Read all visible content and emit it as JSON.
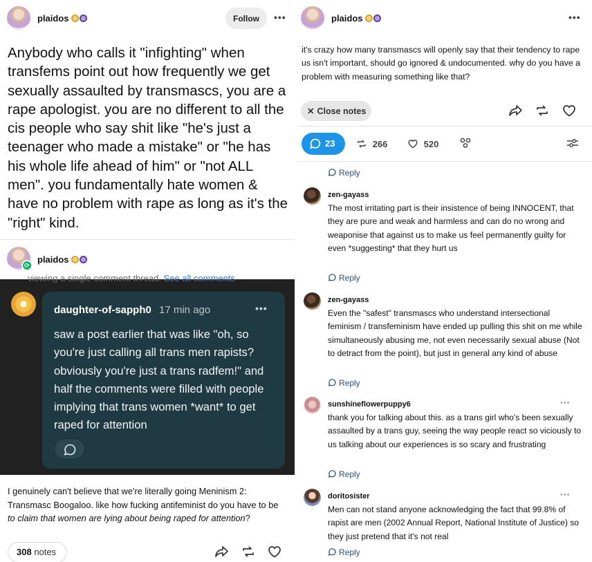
{
  "left_post": {
    "author": "plaidos",
    "follow_label": "Follow",
    "menu_label": "•••",
    "body": "Anybody who calls it \"infighting\" when transfems point out how frequently we get sexually assaulted by transmascs, you are a rape apologist. you are no different to all the cis people who say shit like \"he's just a teenager who made a mistake\" or \"he has his whole life ahead of him\" or \"not ALL men\". you fundamentally hate women & have no problem with rape as long as it's the \"right\" kind.",
    "reblog_author": "plaidos",
    "ghost_text": "viewing a single comment thread.",
    "ghost_link": "See all comments",
    "screenshot_comment": {
      "author": "daughter-of-sapph0",
      "time": "17 min ago",
      "menu_label": "•••",
      "text": "saw a post earlier that was like \"oh, so you're just calling all trans men rapists? obviously you're just a trans radfem!\" and half the comments were filled with people implying that trans women *want* to get raped for attention"
    },
    "caption_plain": "I genuinely can't believe that we're literally going Meninism 2: Transmasc Boogaloo. like how fucking antifeminist do you have to be ",
    "caption_italic": "to claim that women are lying about being raped for attention",
    "caption_end": "?",
    "notes_count": "308",
    "notes_label": "notes"
  },
  "right_post": {
    "author": "plaidos",
    "menu_label": "•••",
    "body": "it's crazy how many transmascs will openly say that their tendency to rape us isn't important, should go ignored & undocumented. why do you have a problem with measuring something like that?",
    "close_notes_label": "Close notes",
    "replies_count": "23",
    "reblogs_count": "266",
    "likes_count": "520",
    "reply_label": "Reply",
    "comments": [
      {
        "author": "zen-gayass",
        "text": "The most irritating part is their insistence of being INNOCENT, that they are pure and weak and harmless and can do no wrong and weaponise that against us to make us feel permanently guilty for even *suggesting* that they hurt us",
        "reply_label": "Reply"
      },
      {
        "author": "zen-gayass",
        "text": "Even the \"safest\" transmascs who understand intersectional feminism / transfeminism have ended up pulling this shit on me while simultaneously abusing me, not even necessarily sexual abuse (Not to detract from the point), but just in general any kind of abuse",
        "reply_label": "Reply"
      },
      {
        "author": "sunshineflowerpuppy6",
        "text": "thank you for talking about this. as a trans girl who's been sexually assaulted by a trans guy, seeing the way people react so viciously to us talking about our experiences is so scary and frustrating",
        "reply_label": "Reply",
        "menu_label": "•••"
      },
      {
        "author": "doritosister",
        "text": "Men can not stand anyone acknowledging the fact that 99.8% of rapist are men (2002 Annual Report, National Institute of Justice) so they just pretend that it's not real",
        "reply_label": "Reply",
        "menu_label": "•••"
      }
    ]
  },
  "colors": {
    "accent_blue": "#1e94e8",
    "repost_green": "#00b85c",
    "dark_bubble": "#203a44",
    "dark_bg": "#212121"
  },
  "icons": [
    "share-icon",
    "reblog-icon",
    "heart-icon",
    "comment-icon",
    "close-icon",
    "filter-icon",
    "people-icon",
    "repost-icon"
  ]
}
